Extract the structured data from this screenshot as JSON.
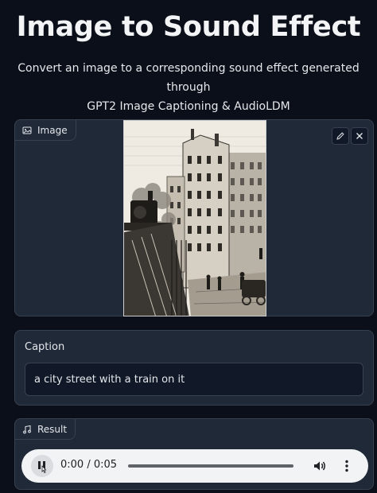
{
  "header": {
    "title": "Image to Sound Effect",
    "subtitle_line1": "Convert an image to a corresponding sound effect generated through",
    "subtitle_line2": "GPT2 Image Captioning & AudioLDM"
  },
  "image_block": {
    "label": "Image",
    "icon": "image-icon",
    "actions": [
      "edit-icon",
      "close-icon"
    ]
  },
  "caption_block": {
    "label": "Caption",
    "value": "a city street with a train on it"
  },
  "result_block": {
    "label": "Result",
    "icon": "music-note-icon",
    "player": {
      "time": "0:00 / 0:05",
      "progress": 0
    }
  },
  "colors": {
    "background": "#0b0f19",
    "panel": "#1f2937",
    "border": "#374151",
    "player_bg": "#f1f3f4"
  }
}
